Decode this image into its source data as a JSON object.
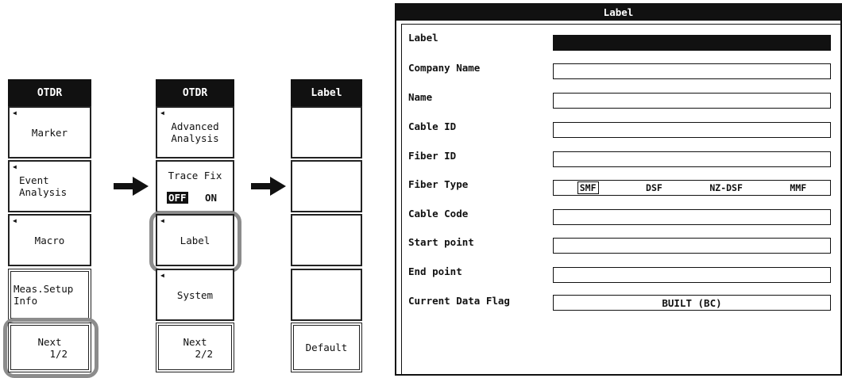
{
  "menu1": {
    "header": "OTDR",
    "keys": [
      {
        "label": "Marker"
      },
      {
        "label": "Event\nAnalysis"
      },
      {
        "label": "Macro"
      },
      {
        "label": "Meas.Setup\nInfo"
      },
      {
        "label": "Next\n   1/2"
      }
    ]
  },
  "menu2": {
    "header": "OTDR",
    "keys": [
      {
        "label": "Advanced\nAnalysis"
      },
      {
        "label": "Trace Fix",
        "off": "OFF",
        "on": "ON"
      },
      {
        "label": "Label"
      },
      {
        "label": "System"
      },
      {
        "label": "Next\n   2/2"
      }
    ]
  },
  "menu3": {
    "header": "Label",
    "keys": [
      {
        "label": ""
      },
      {
        "label": ""
      },
      {
        "label": ""
      },
      {
        "label": ""
      },
      {
        "label": "Default"
      }
    ]
  },
  "dialog": {
    "title": "Label",
    "fields": [
      {
        "label": "Label",
        "value": ""
      },
      {
        "label": "Company Name",
        "value": ""
      },
      {
        "label": "Name",
        "value": ""
      },
      {
        "label": "Cable ID",
        "value": ""
      },
      {
        "label": "Fiber ID",
        "value": ""
      },
      {
        "label": "Fiber Type",
        "options": [
          "SMF",
          "DSF",
          "NZ-DSF",
          "MMF"
        ],
        "selected": "SMF"
      },
      {
        "label": "Cable Code",
        "value": ""
      },
      {
        "label": "Start point",
        "value": ""
      },
      {
        "label": "End point",
        "value": ""
      },
      {
        "label": "Current Data Flag",
        "value": "BUILT (BC)"
      }
    ]
  },
  "icons": {
    "flow_arrow": "right-arrow-icon",
    "softkey_marker": "triangle-left-icon"
  }
}
